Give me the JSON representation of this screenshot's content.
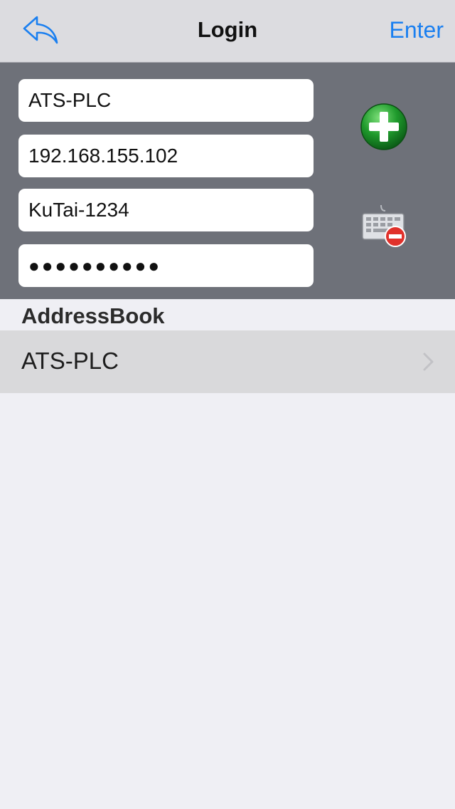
{
  "nav": {
    "back_icon": "reply-arrow-icon",
    "title": "Login",
    "enter_label": "Enter",
    "accent_color": "#1a7ff0"
  },
  "form": {
    "name_value": "ATS-PLC",
    "ip_value": "192.168.155.102",
    "user_value": "KuTai-1234",
    "password_value": "●●●●●●●●●●",
    "add_icon": "green-plus-icon",
    "keyboard_icon": "keyboard-hide-icon"
  },
  "address_book": {
    "header": "AddressBook",
    "items": [
      {
        "label": "ATS-PLC",
        "icon": "chevron-right-icon"
      }
    ]
  }
}
